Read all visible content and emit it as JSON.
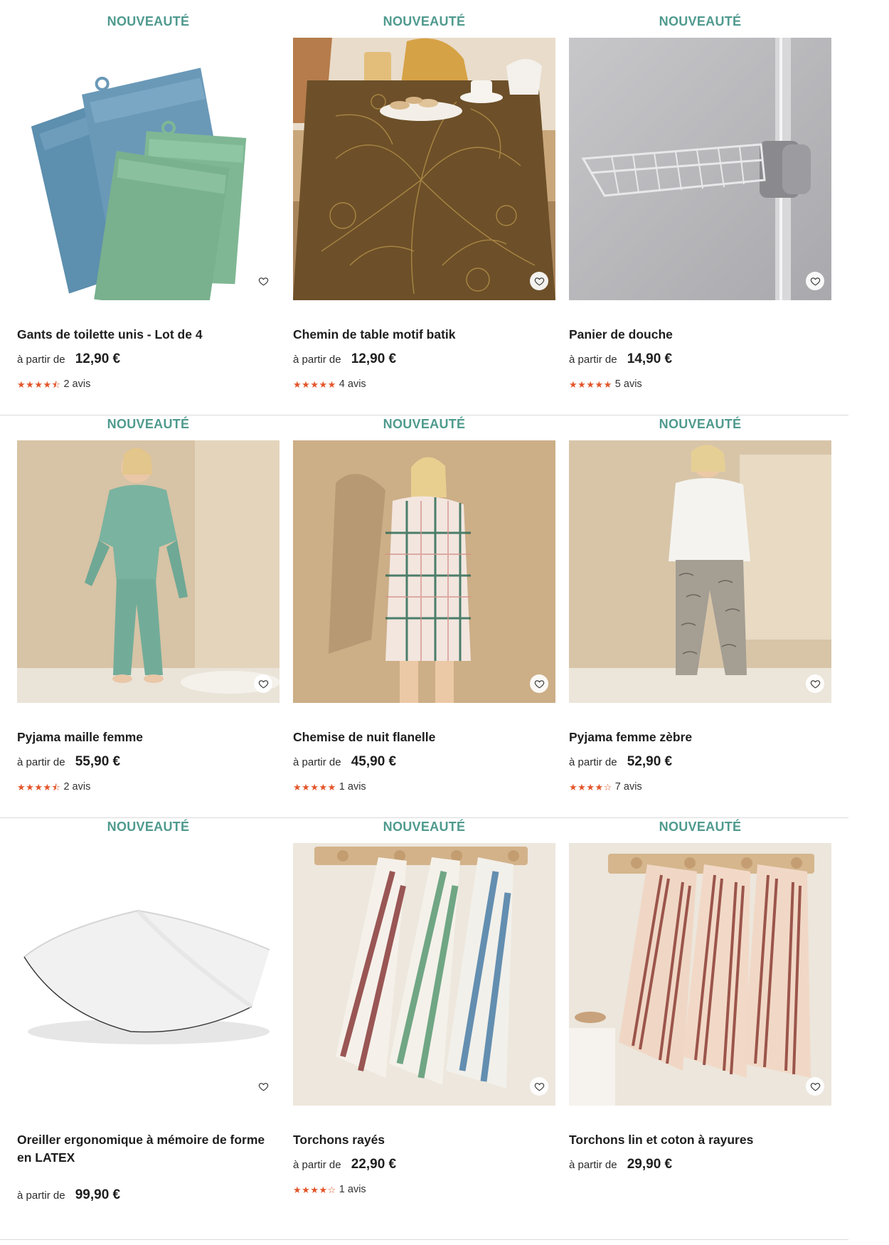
{
  "badge_label": "NOUVEAUTÉ",
  "from_label": "à partir de",
  "accent_color": "#4f9a8e",
  "star_color": "#e3552a",
  "products": [
    {
      "title": "Gants de toilette unis - Lot de 4",
      "price": "12,90 €",
      "rating": 4.5,
      "reviews": "2 avis",
      "image": "towel-mitts",
      "favorite_icon": "heart-icon"
    },
    {
      "title": "Chemin de table motif batik",
      "price": "12,90 €",
      "rating": 5,
      "reviews": "4 avis",
      "image": "table-runner",
      "favorite_icon": "heart-icon"
    },
    {
      "title": "Panier de douche",
      "price": "14,90 €",
      "rating": 5,
      "reviews": "5 avis",
      "image": "shower-basket",
      "favorite_icon": "heart-icon"
    },
    {
      "title": "Pyjama maille femme",
      "price": "55,90 €",
      "rating": 4.5,
      "reviews": "2 avis",
      "image": "green-pyjama",
      "favorite_icon": "heart-icon"
    },
    {
      "title": "Chemise de nuit flanelle",
      "price": "45,90 €",
      "rating": 5,
      "reviews": "1 avis",
      "image": "plaid-nightshirt",
      "favorite_icon": "heart-icon"
    },
    {
      "title": "Pyjama femme zèbre",
      "price": "52,90 €",
      "rating": 4,
      "reviews": "7 avis",
      "image": "zebra-pyjama",
      "favorite_icon": "heart-icon"
    },
    {
      "title": "Oreiller ergonomique à mémoire de forme en LATEX",
      "price": "99,90 €",
      "rating": null,
      "reviews": null,
      "image": "pillow",
      "favorite_icon": "heart-icon"
    },
    {
      "title": "Torchons rayés",
      "price": "22,90 €",
      "rating": 4,
      "reviews": "1 avis",
      "image": "striped-towels",
      "favorite_icon": "heart-icon"
    },
    {
      "title": "Torchons lin et coton à rayures",
      "price": "29,90 €",
      "rating": null,
      "reviews": null,
      "image": "linen-towels",
      "favorite_icon": "heart-icon"
    }
  ]
}
